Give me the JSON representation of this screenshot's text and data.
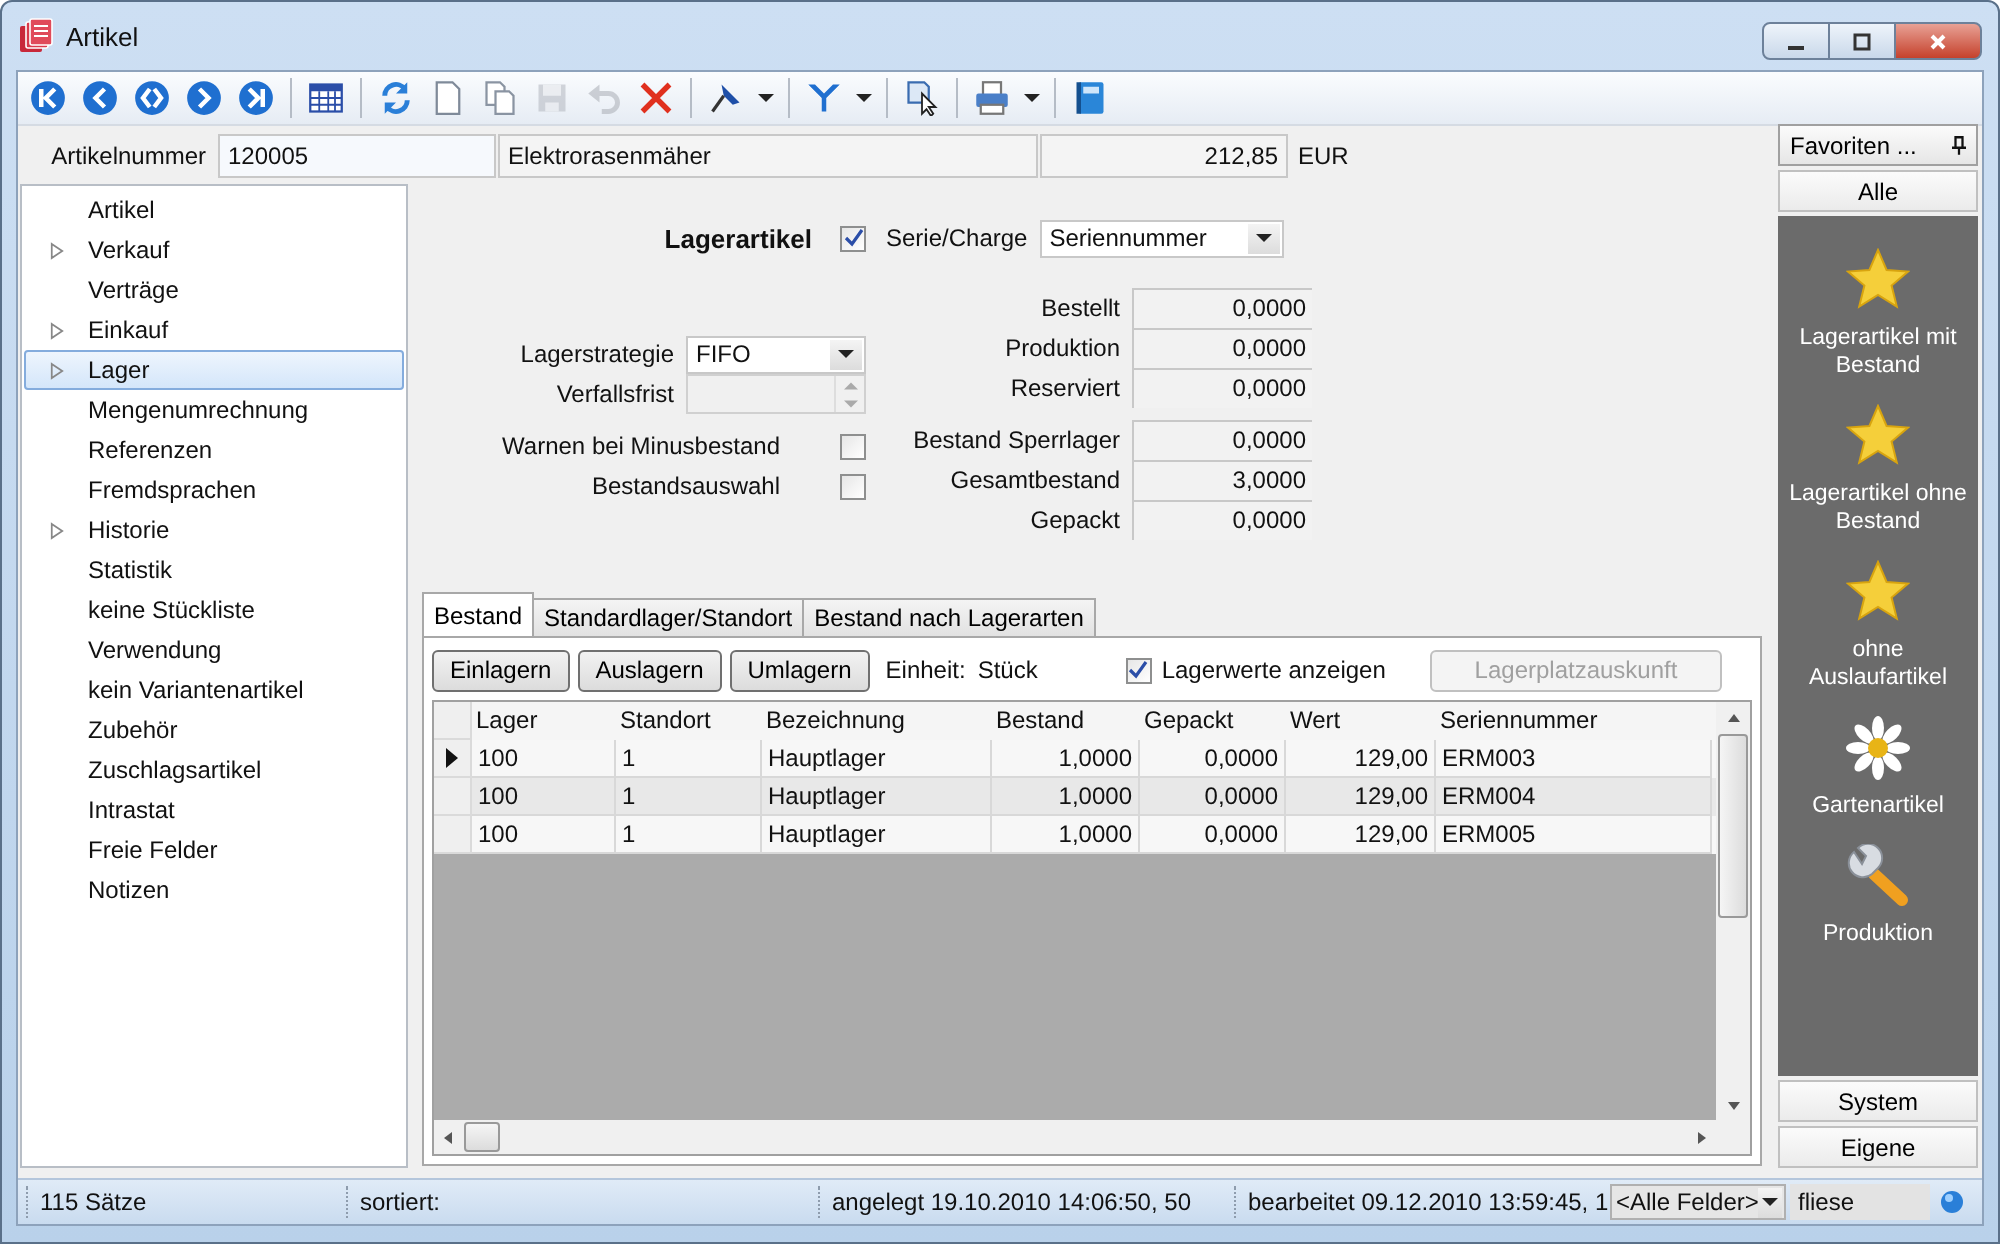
{
  "window": {
    "title": "Artikel"
  },
  "toolbar": [
    {
      "kind": "first",
      "disabled": false
    },
    {
      "kind": "prev",
      "disabled": false
    },
    {
      "kind": "jump",
      "disabled": false
    },
    {
      "kind": "next",
      "disabled": false
    },
    {
      "kind": "last",
      "disabled": false
    },
    {
      "kind": "separator"
    },
    {
      "kind": "grid",
      "disabled": false
    },
    {
      "kind": "separator"
    },
    {
      "kind": "refresh",
      "disabled": false
    },
    {
      "kind": "new",
      "disabled": false
    },
    {
      "kind": "copy",
      "disabled": false
    },
    {
      "kind": "save",
      "disabled": true
    },
    {
      "kind": "undo",
      "disabled": true
    },
    {
      "kind": "delete",
      "disabled": false
    },
    {
      "kind": "separator"
    },
    {
      "kind": "pin",
      "disabled": false,
      "dropdown": true
    },
    {
      "kind": "separator"
    },
    {
      "kind": "filter",
      "disabled": false,
      "dropdown": true
    },
    {
      "kind": "separator"
    },
    {
      "kind": "pointer",
      "disabled": false
    },
    {
      "kind": "separator"
    },
    {
      "kind": "print",
      "disabled": false,
      "dropdown": true
    },
    {
      "kind": "separator"
    },
    {
      "kind": "book",
      "disabled": false
    }
  ],
  "header": {
    "label": "Artikelnummer",
    "number": "120005",
    "name": "Elektrorasenmäher",
    "price": "212,85",
    "currency": "EUR"
  },
  "sidebar": {
    "items": [
      {
        "label": "Artikel",
        "expandable": false,
        "selected": false
      },
      {
        "label": "Verkauf",
        "expandable": true,
        "selected": false
      },
      {
        "label": "Verträge",
        "expandable": false,
        "selected": false
      },
      {
        "label": "Einkauf",
        "expandable": true,
        "selected": false
      },
      {
        "label": "Lager",
        "expandable": true,
        "selected": true
      },
      {
        "label": "Mengenumrechnung",
        "expandable": false,
        "selected": false
      },
      {
        "label": "Referenzen",
        "expandable": false,
        "selected": false
      },
      {
        "label": "Fremdsprachen",
        "expandable": false,
        "selected": false
      },
      {
        "label": "Historie",
        "expandable": true,
        "selected": false
      },
      {
        "label": "Statistik",
        "expandable": false,
        "selected": false
      },
      {
        "label": "keine Stückliste",
        "expandable": false,
        "selected": false
      },
      {
        "label": "Verwendung",
        "expandable": false,
        "selected": false
      },
      {
        "label": "kein Variantenartikel",
        "expandable": false,
        "selected": false
      },
      {
        "label": "Zubehör",
        "expandable": false,
        "selected": false
      },
      {
        "label": "Zuschlagsartikel",
        "expandable": false,
        "selected": false
      },
      {
        "label": "Intrastat",
        "expandable": false,
        "selected": false
      },
      {
        "label": "Freie Felder",
        "expandable": false,
        "selected": false
      },
      {
        "label": "Notizen",
        "expandable": false,
        "selected": false
      }
    ]
  },
  "stock_form": {
    "lagerartikel": {
      "label": "Lagerartikel",
      "checked": true
    },
    "serie_charge": {
      "label": "Serie/Charge",
      "value": "Seriennummer"
    },
    "lagerstrategie": {
      "label": "Lagerstrategie",
      "value": "FIFO"
    },
    "verfallsfrist": {
      "label": "Verfallsfrist",
      "disabled": true
    },
    "checks": [
      {
        "label": "Warnen bei Minusbestand",
        "checked": false
      },
      {
        "label": "Bestandsauswahl",
        "checked": false
      }
    ]
  },
  "quantity_groups": [
    {
      "items": [
        {
          "label": "Bestellt",
          "value": "0,0000"
        },
        {
          "label": "Produktion",
          "value": "0,0000"
        },
        {
          "label": "Reserviert",
          "value": "0,0000"
        }
      ]
    },
    {
      "items": [
        {
          "label": "Bestand Sperrlager",
          "value": "0,0000"
        },
        {
          "label": "Gesamtbestand",
          "value": "3,0000"
        },
        {
          "label": "Gepackt",
          "value": "0,0000"
        }
      ]
    }
  ],
  "tabs": [
    {
      "label": "Bestand",
      "selected": true
    },
    {
      "label": "Standardlager/Standort",
      "selected": false
    },
    {
      "label": "Bestand nach Lagerarten",
      "selected": false
    }
  ],
  "stock_actions": [
    {
      "label": "Einlagern"
    },
    {
      "label": "Auslagern"
    },
    {
      "label": "Umlagern"
    }
  ],
  "unit": {
    "label": "Einheit:",
    "value": "Stück"
  },
  "show_values": {
    "label": "Lagerwerte anzeigen",
    "checked": true
  },
  "location_info": {
    "label": "Lagerplatzauskunft",
    "disabled": true
  },
  "table": {
    "columns": [
      "Lager",
      "Standort",
      "Bezeichnung",
      "Bestand",
      "Gepackt",
      "Wert",
      "Seriennummer"
    ],
    "rows": [
      {
        "selected": true,
        "cells": [
          "100",
          "1",
          "Hauptlager",
          "1,0000",
          "0,0000",
          "129,00",
          "ERM003"
        ]
      },
      {
        "selected": false,
        "cells": [
          "100",
          "1",
          "Hauptlager",
          "1,0000",
          "0,0000",
          "129,00",
          "ERM004"
        ]
      },
      {
        "selected": false,
        "cells": [
          "100",
          "1",
          "Hauptlager",
          "1,0000",
          "0,0000",
          "129,00",
          "ERM005"
        ]
      }
    ]
  },
  "favorites": {
    "title": "Favoriten ...",
    "sections": [
      {
        "label": "Alle",
        "items": [
          {
            "label": "Lagerartikel mit Bestand",
            "kind": "star"
          },
          {
            "label": "Lagerartikel ohne Bestand",
            "kind": "star"
          },
          {
            "label": "ohne Auslaufartikel",
            "kind": "star"
          },
          {
            "label": "Gartenartikel",
            "kind": "flower"
          },
          {
            "label": "Produktion",
            "kind": "wrench"
          }
        ]
      },
      {
        "label": "System"
      },
      {
        "label": "Eigene"
      }
    ]
  },
  "status_bar": {
    "records": "115 Sätze",
    "sort": "sortiert:",
    "created": "angelegt 19.10.2010 14:06:50, 50",
    "edited": "bearbeitet 09.12.2010 13:59:45, 1",
    "field_filter": "<Alle Felder>",
    "search": "fliese"
  }
}
